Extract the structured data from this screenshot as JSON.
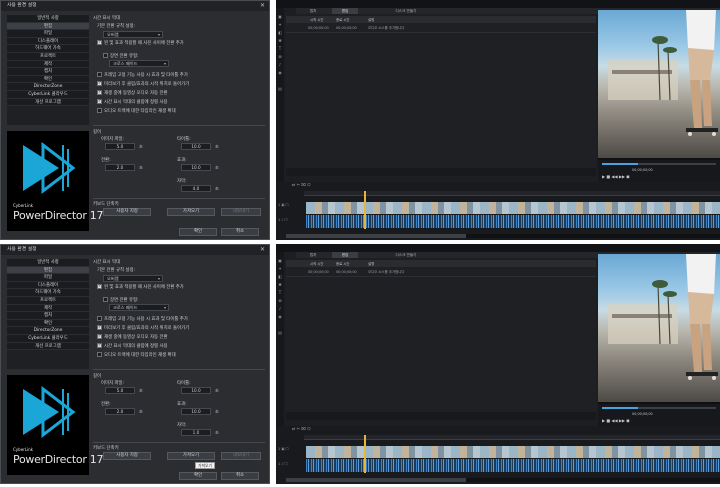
{
  "panels": [
    {
      "dialog": {
        "title": "사용 환경 설정",
        "close_icon": "close-icon",
        "menu": [
          "일반적 사항",
          "편집",
          "파일",
          "디스플레이",
          "하드웨어 가속",
          "프로젝트",
          "제작",
          "캡처",
          "확인",
          "DirectorZone",
          "CyberLink 클라우드",
          "개선 프로그램"
        ],
        "selected_menu": "편집",
        "logo": {
          "brand": "CyberLink",
          "name": "PowerDirector 17"
        },
        "timeline_section": "시간 표시 막대",
        "default_transition_label": "기본 전환 규칙 설정:",
        "default_transition_value": "오버랩",
        "checkboxes": [
          {
            "label": "왼 및 효과 적용할 때 사진 사이에 전환 추가",
            "checked": true
          },
          {
            "label": "장면 전환 유형:",
            "checked": false
          },
          {
            "label": "프레임 고정 기능 사용 시 효과 및 타이틀 추가",
            "checked": false
          },
          {
            "label": "미리보기 후 클립/효과의 시작 위치로 돌아가기",
            "checked": true
          },
          {
            "label": "재생 중에 동영상 오디오 자동 전환",
            "checked": true
          },
          {
            "label": "시간 표시 막대의 클립에 정렬 사용",
            "checked": true
          },
          {
            "label": "오디오 트랙에 대한 타임라인 재생 확대",
            "checked": false
          }
        ],
        "transition_type_value": "크로스 페이드",
        "duration_section": "길이",
        "fields": [
          {
            "label": "이미지 파일:",
            "value": "5.0",
            "unit": "초"
          },
          {
            "label": "타이틀:",
            "value": "10.0",
            "unit": "초"
          },
          {
            "label": "전환:",
            "value": "2.0",
            "unit": "초"
          },
          {
            "label": "효과:",
            "value": "10.0",
            "unit": "초"
          },
          {
            "label": "자막:",
            "value": "4.0",
            "unit": "초"
          }
        ],
        "keyboard_section": "키보드 단축키",
        "buttons": {
          "user_set": "사용자 지정",
          "import": "가져오기",
          "export": "내보내기"
        },
        "ok": "확인",
        "cancel": "취소",
        "tooltip": ""
      },
      "editor": {
        "tabs": [
          "캡처",
          "편집",
          "디스크 만들기"
        ],
        "active_tab": "편집",
        "lib_header": [
          "이름",
          "시작 시간",
          "종료 시간",
          "설명"
        ],
        "rows": [
          {
            "name": "",
            "start": "00;00;00;00",
            "end": "00;00;00;00",
            "desc": "오디오 소스를 추가합니다"
          }
        ],
        "preview_time": "00;00;00;00",
        "timeline_time": "00;00;00;00"
      }
    },
    {
      "dialog": {
        "title": "사용 환경 설정",
        "close_icon": "close-icon",
        "menu": [
          "일반적 사항",
          "편집",
          "파일",
          "디스플레이",
          "하드웨어 가속",
          "프로젝트",
          "제작",
          "캡처",
          "확인",
          "DirectorZone",
          "CyberLink 클라우드",
          "개선 프로그램"
        ],
        "selected_menu": "편집",
        "logo": {
          "brand": "CyberLink",
          "name": "PowerDirector 17"
        },
        "timeline_section": "시간 표시 막대",
        "default_transition_label": "기본 전환 규칙 설정:",
        "default_transition_value": "오버랩",
        "checkboxes": [
          {
            "label": "왼 및 효과 적용할 때 사진 사이에 전환 추가",
            "checked": true
          },
          {
            "label": "장면 전환 유형:",
            "checked": false
          },
          {
            "label": "프레임 고정 기능 사용 시 효과 및 타이틀 추가",
            "checked": false
          },
          {
            "label": "미리보기 후 클립/효과의 시작 위치로 돌아가기",
            "checked": true
          },
          {
            "label": "재생 중에 동영상 오디오 자동 전환",
            "checked": true
          },
          {
            "label": "시간 표시 막대의 클립에 정렬 사용",
            "checked": true
          },
          {
            "label": "오디오 트랙에 대한 타임라인 재생 확대",
            "checked": false
          }
        ],
        "transition_type_value": "크로스 페이드",
        "duration_section": "길이",
        "fields": [
          {
            "label": "이미지 파일:",
            "value": "5.0",
            "unit": "초"
          },
          {
            "label": "타이틀:",
            "value": "10.0",
            "unit": "초"
          },
          {
            "label": "전환:",
            "value": "2.0",
            "unit": "초"
          },
          {
            "label": "효과:",
            "value": "10.0",
            "unit": "초"
          },
          {
            "label": "자막:",
            "value": "1.0",
            "unit": "초"
          }
        ],
        "keyboard_section": "키보드 단축키",
        "buttons": {
          "user_set": "사용자 지정",
          "import": "가져오기",
          "export": "내보내기"
        },
        "ok": "확인",
        "cancel": "취소",
        "tooltip": "가져오기"
      },
      "editor": {
        "tabs": [
          "캡처",
          "편집",
          "디스크 만들기"
        ],
        "active_tab": "편집",
        "lib_header": [
          "이름",
          "시작 시간",
          "종료 시간",
          "설명"
        ],
        "rows": [
          {
            "name": "",
            "start": "00;00;00;00",
            "end": "00;00;00;00",
            "desc": "오디오 소스를 추가합니다"
          }
        ],
        "preview_time": "00;00;00;00",
        "timeline_time": "00;00;00;00"
      }
    }
  ]
}
